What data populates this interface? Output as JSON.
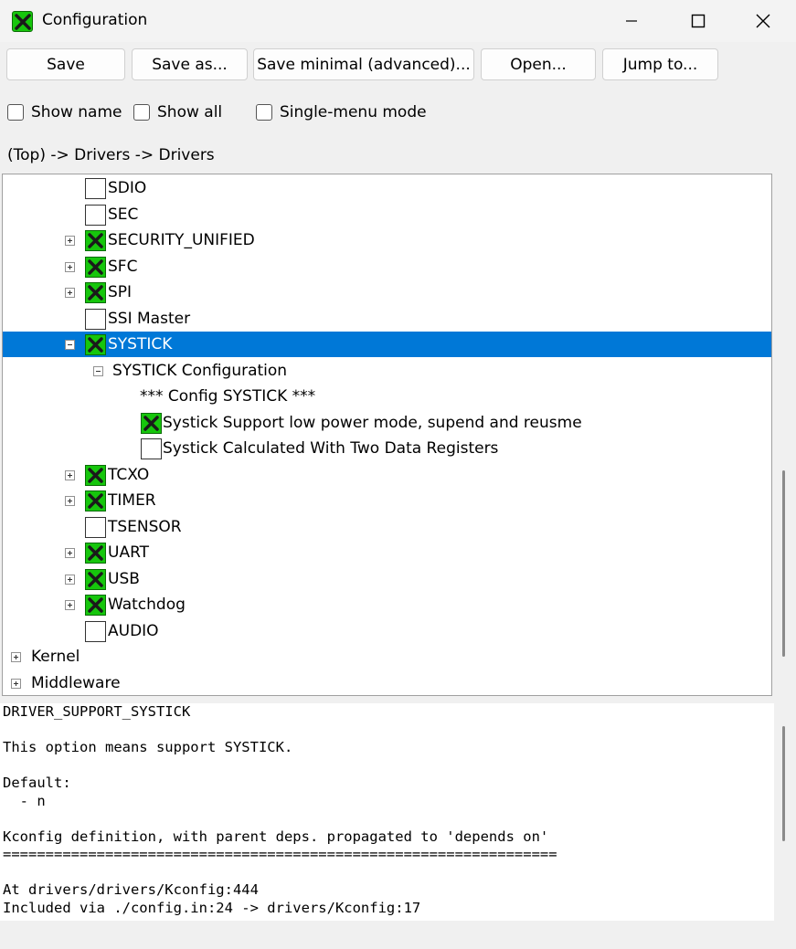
{
  "window": {
    "title": "Configuration"
  },
  "toolbar": {
    "save": "Save",
    "save_as": "Save as...",
    "save_minimal": "Save minimal (advanced)...",
    "open": "Open...",
    "jump_to": "Jump to..."
  },
  "options": {
    "show_name": "Show name",
    "show_all": "Show all",
    "single_menu": "Single-menu mode"
  },
  "breadcrumb": "(Top) -> Drivers -> Drivers",
  "tree": {
    "sdio": "SDIO",
    "sec": "SEC",
    "security_unified": "SECURITY_UNIFIED",
    "sfc": "SFC",
    "spi": "SPI",
    "ssi_master": "SSI Master",
    "systick": "SYSTICK",
    "systick_config": "SYSTICK Configuration",
    "config_systick_comment": "*** Config SYSTICK ***",
    "systick_lowpower": "Systick Support low power mode, supend and reusme",
    "systick_two_regs": "Systick Calculated With Two Data Registers",
    "tcxo": "TCXO",
    "timer": "TIMER",
    "tsensor": "TSENSOR",
    "uart": "UART",
    "usb": "USB",
    "watchdog": "Watchdog",
    "audio": "AUDIO",
    "kernel": "Kernel",
    "middleware": "Middleware"
  },
  "info": {
    "symbol": "DRIVER_SUPPORT_SYSTICK",
    "description": "This option means support SYSTICK.",
    "default_label": "Default:",
    "default_value": "  - n",
    "kconfig_def": "Kconfig definition, with parent deps. propagated to 'depends on'",
    "separator": "=================================================================",
    "location": "At drivers/drivers/Kconfig:444",
    "included": "Included via ./config.in:24 -> drivers/Kconfig:17"
  },
  "colors": {
    "selection": "#0078d7",
    "checked_green": "#16c60c"
  }
}
